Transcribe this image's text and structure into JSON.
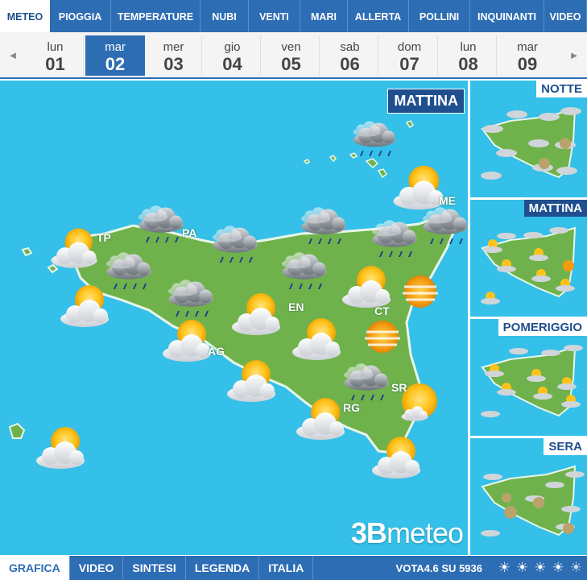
{
  "tabs": [
    {
      "label": "METEO",
      "active": true
    },
    {
      "label": "PIOGGIA"
    },
    {
      "label": "TEMPERATURE"
    },
    {
      "label": "NUBI"
    },
    {
      "label": "VENTI"
    },
    {
      "label": "MARI"
    },
    {
      "label": "ALLERTA"
    },
    {
      "label": "POLLINI"
    },
    {
      "label": "INQUINANTI"
    },
    {
      "label": "VIDEO"
    }
  ],
  "days": [
    {
      "name": "lun",
      "num": "01"
    },
    {
      "name": "mar",
      "num": "02",
      "selected": true
    },
    {
      "name": "mer",
      "num": "03"
    },
    {
      "name": "gio",
      "num": "04"
    },
    {
      "name": "ven",
      "num": "05"
    },
    {
      "name": "sab",
      "num": "06"
    },
    {
      "name": "dom",
      "num": "07"
    },
    {
      "name": "lun",
      "num": "08"
    },
    {
      "name": "mar",
      "num": "09"
    }
  ],
  "nav": {
    "prev": "◄",
    "next": "►"
  },
  "map": {
    "period": "MATTINA",
    "province_labels": [
      "TP",
      "PA",
      "ME",
      "EN",
      "CT",
      "AG",
      "SR",
      "RG"
    ],
    "logo_num": "3B",
    "logo_text": "meteo"
  },
  "side_panels": [
    {
      "label": "NOTTE"
    },
    {
      "label": "MATTINA",
      "active": true
    },
    {
      "label": "POMERIGGIO"
    },
    {
      "label": "SERA"
    }
  ],
  "bottom_tabs": [
    {
      "label": "GRAFICA",
      "active": true
    },
    {
      "label": "VIDEO"
    },
    {
      "label": "SINTESI"
    },
    {
      "label": "LEGENDA"
    },
    {
      "label": "ITALIA"
    }
  ],
  "vote": {
    "text": "VOTA",
    "score": "4.6",
    "su": "SU",
    "count": "5936"
  },
  "vote_star_glyph": "☀",
  "colors": {
    "accent": "#2d6db4",
    "sea": "#34c0e8",
    "land": "#6fb24c",
    "dark": "#1f4f8e"
  }
}
